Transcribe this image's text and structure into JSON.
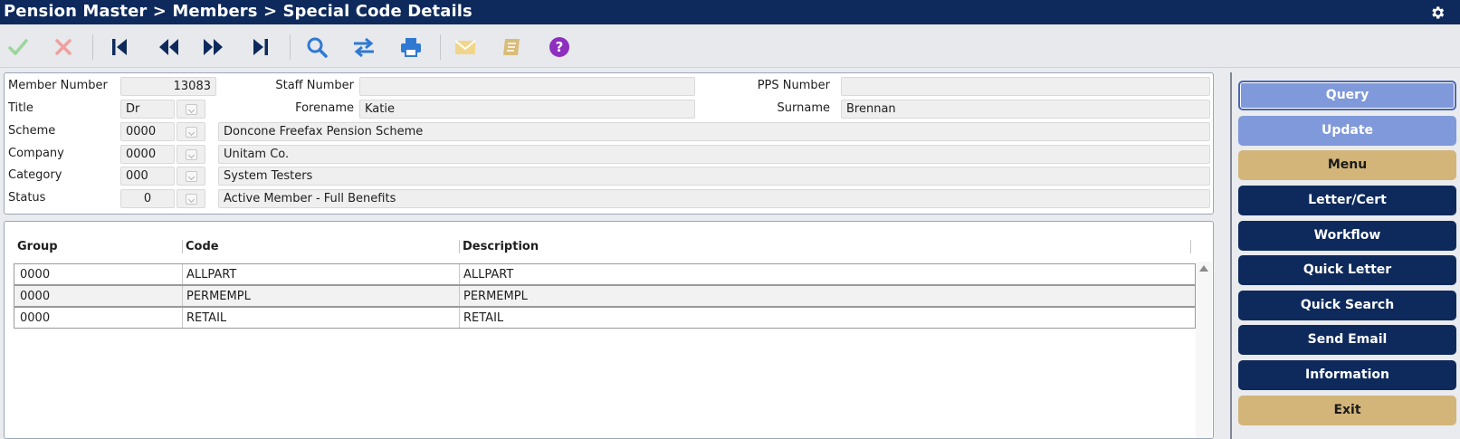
{
  "title": "Pension Master > Members > Special Code Details",
  "colors": {
    "titlebar": "#0e2a5c",
    "accent_blue": "#7f99da",
    "gold": "#d3b57a",
    "navy": "#0e2a5c"
  },
  "toolbar": {
    "icons": [
      "check-icon",
      "cross-icon",
      "first-record-icon",
      "previous-record-icon",
      "next-record-icon",
      "last-record-icon",
      "search-icon",
      "swap-icon",
      "print-icon",
      "email-icon",
      "notes-book-icon",
      "help-icon"
    ]
  },
  "member": {
    "member_number_label": "Member Number",
    "member_number": "13083",
    "staff_number_label": "Staff Number",
    "staff_number": "",
    "pps_number_label": "PPS Number",
    "pps_number": "",
    "title_label": "Title",
    "title": "Dr",
    "forename_label": "Forename",
    "forename": "Katie",
    "surname_label": "Surname",
    "surname": "Brennan",
    "scheme_label": "Scheme",
    "scheme_code": "0000",
    "scheme_desc": "Doncone Freefax Pension Scheme",
    "company_label": "Company",
    "company_code": "0000",
    "company_desc": "Unitam Co.",
    "category_label": "Category",
    "category_code": "000",
    "category_desc": "System Testers",
    "status_label": "Status",
    "status_code": "0",
    "status_desc": "Active Member - Full Benefits"
  },
  "grid": {
    "columns": [
      "Group",
      "Code",
      "Description"
    ],
    "rows": [
      {
        "group": "0000",
        "code": "ALLPART",
        "description": "ALLPART"
      },
      {
        "group": "0000",
        "code": "PERMEMPL",
        "description": "PERMEMPL"
      },
      {
        "group": "0000",
        "code": "RETAIL",
        "description": "RETAIL"
      }
    ]
  },
  "sidebar": {
    "buttons": [
      "Query",
      "Update",
      "Menu",
      "Letter/Cert",
      "Workflow",
      "Quick Letter",
      "Quick Search",
      "Send Email",
      "Information",
      "Exit"
    ]
  }
}
